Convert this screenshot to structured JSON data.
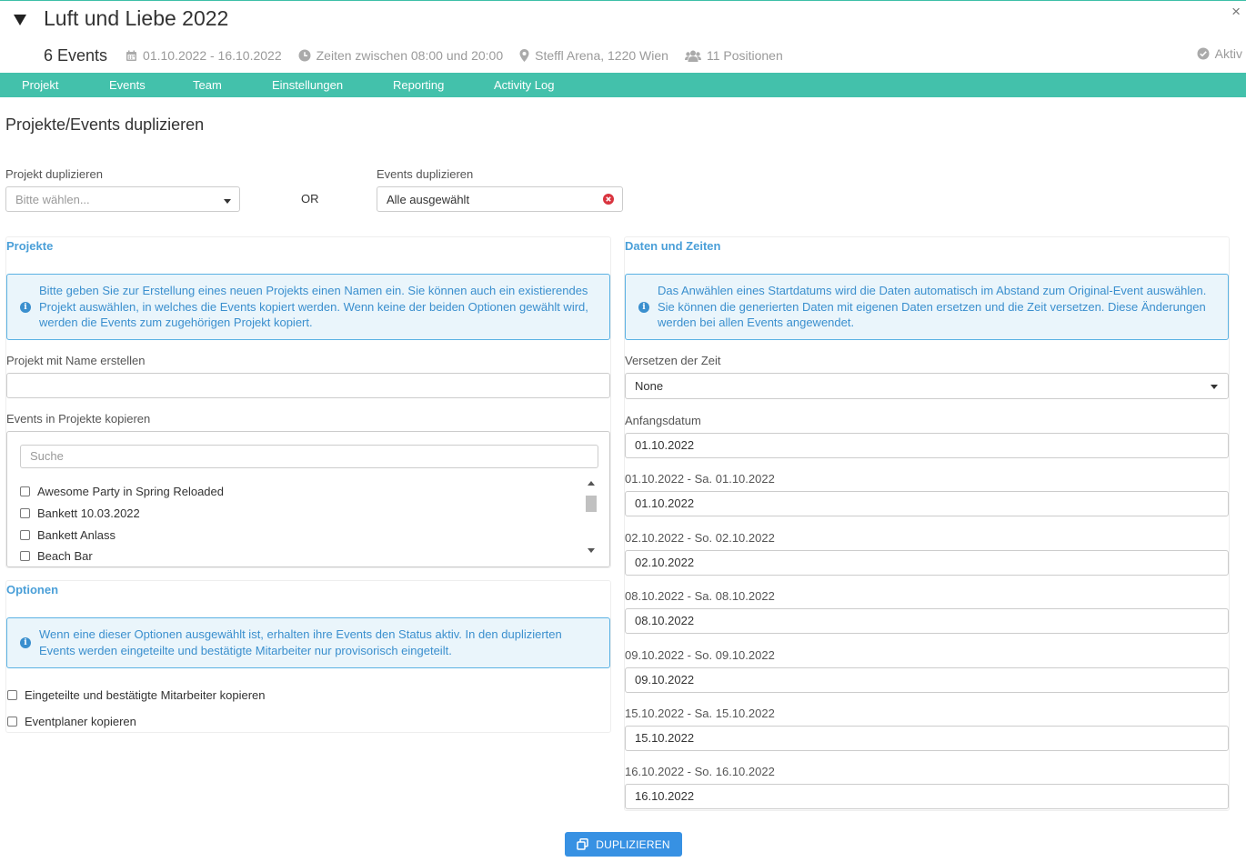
{
  "header": {
    "title": "Luft und Liebe 2022",
    "events_count": "6 Events",
    "date_range": "01.10.2022 - 16.10.2022",
    "times": "Zeiten zwischen 08:00 und 20:00",
    "location": "Steffl Arena, 1220 Wien",
    "positions": "11 Positionen",
    "status": "Aktiv",
    "close_symbol": "×"
  },
  "nav": {
    "tabs": [
      "Projekt",
      "Events",
      "Team",
      "Einstellungen",
      "Reporting",
      "Activity Log"
    ]
  },
  "page": {
    "title": "Projekte/Events duplizieren"
  },
  "duplicate": {
    "project_label": "Projekt duplizieren",
    "project_placeholder": "Bitte wählen...",
    "or_label": "OR",
    "events_label": "Events duplizieren",
    "events_value": "Alle ausgewählt"
  },
  "projects_panel": {
    "title": "Projekte",
    "info": "Bitte geben Sie zur Erstellung eines neuen Projekts einen Namen ein. Sie können auch ein existierendes Projekt auswählen, in welches die Events kopiert werden. Wenn keine der beiden Optionen gewählt wird, werden die Events zum zugehörigen Projekt kopiert.",
    "create_label": "Projekt mit Name erstellen",
    "create_value": "",
    "copy_label": "Events in Projekte kopieren",
    "search_placeholder": "Suche",
    "items": [
      "Awesome Party in Spring Reloaded",
      "Bankett 10.03.2022",
      "Bankett Anlass",
      "Beach Bar"
    ]
  },
  "options_panel": {
    "title": "Optionen",
    "info": "Wenn eine dieser Optionen ausgewählt ist, erhalten ihre Events den Status aktiv. In den duplizierten Events werden eingeteilte und bestätigte Mitarbeiter nur provisorisch eingeteilt.",
    "options": [
      "Eingeteilte und bestätigte Mitarbeiter kopieren",
      "Eventplaner kopieren"
    ]
  },
  "dates_panel": {
    "title": "Daten und Zeiten",
    "info": "Das Anwählen eines Startdatums wird die Daten automatisch im Abstand zum Original-Event auswählen. Sie können die generierten Daten mit eigenen Daten ersetzen und die Zeit versetzen. Diese Änderungen werden bei allen Events angewendet.",
    "shift_label": "Versetzen der Zeit",
    "shift_value": "None",
    "start_label": "Anfangsdatum",
    "start_value": "01.10.2022",
    "events": [
      {
        "label": "01.10.2022 - Sa. 01.10.2022",
        "value": "01.10.2022"
      },
      {
        "label": "02.10.2022 - So. 02.10.2022",
        "value": "02.10.2022"
      },
      {
        "label": "08.10.2022 - Sa. 08.10.2022",
        "value": "08.10.2022"
      },
      {
        "label": "09.10.2022 - So. 09.10.2022",
        "value": "09.10.2022"
      },
      {
        "label": "15.10.2022 - Sa. 15.10.2022",
        "value": "15.10.2022"
      },
      {
        "label": "16.10.2022 - So. 16.10.2022",
        "value": "16.10.2022"
      }
    ]
  },
  "actions": {
    "duplicate_label": "DUPLIZIEREN"
  },
  "colors": {
    "nav_bg": "#43c1ab",
    "info_bg": "#eaf5fb",
    "info_border": "#5bb2e3",
    "info_text": "#3a8fce",
    "panel_title": "#4a9fd8",
    "button_bg": "#3791e3",
    "clear_icon": "#d9343f"
  },
  "icons": {
    "filter": "filter-icon",
    "calendar": "calendar-icon",
    "clock": "clock-icon",
    "location": "map-marker-icon",
    "users": "users-icon",
    "status": "check-circle-icon",
    "info": "info-icon",
    "clear": "times-circle-icon",
    "copy": "copy-icon"
  }
}
